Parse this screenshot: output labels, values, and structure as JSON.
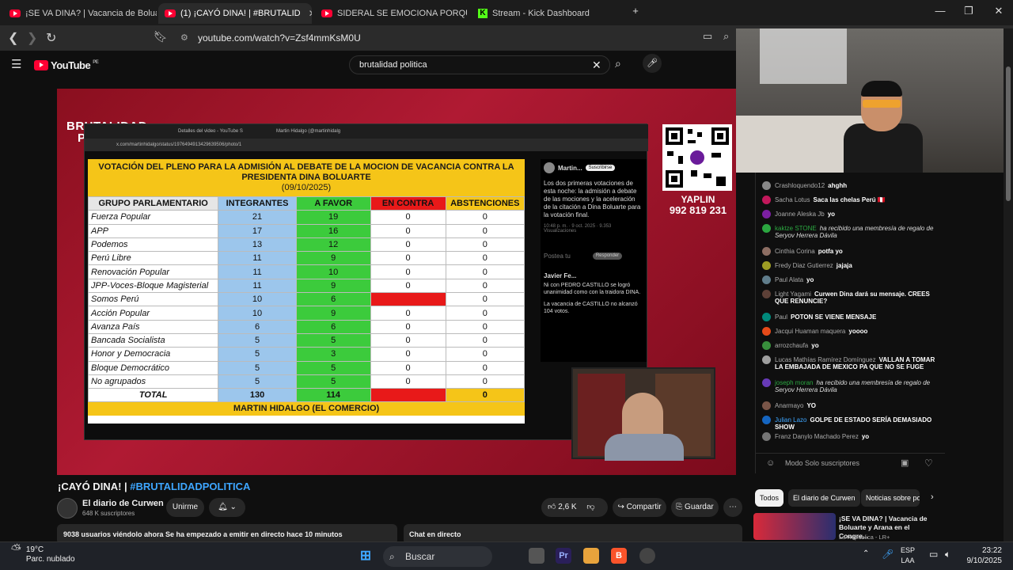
{
  "browser": {
    "tabs": [
      {
        "label": "¡SE VA DINA? | Vacancia de Bolua",
        "active": false
      },
      {
        "label": "(1) ¡CAYÓ DINA! | #BRUTALID",
        "active": true
      },
      {
        "label": "SIDERAL SE EMOCIONA PORQUE KIC",
        "active": false
      },
      {
        "label": "Stream - Kick Dashboard",
        "active": false
      }
    ],
    "url": "youtube.com/watch?v=Zsf4mmKsM0U"
  },
  "youtube": {
    "logo_text": "YouTube",
    "country": "PE",
    "search_value": "brutalidad politica"
  },
  "video": {
    "brand_line1": "BRUTALIDAD",
    "brand_line2": "POLÍTICA",
    "screen_tabs": [
      "Detalles del video - YouTube S",
      "Martin Hidalgo (@martinhidalg"
    ],
    "screen_url": "x.com/martinhidalgo/status/1976494913429639506/photo/1",
    "table_title": "VOTACIÓN DEL PLENO PARA LA ADMISIÓN AL DEBATE DE LA MOCION DE VACANCIA CONTRA LA PRESIDENTA DINA BOLUARTE",
    "table_date": "(09/10/2025)",
    "headers": [
      "GRUPO PARLAMENTARIO",
      "INTEGRANTES",
      "A FAVOR",
      "EN CONTRA",
      "ABSTENCIONES"
    ],
    "rows": [
      {
        "g": "Fuerza Popular",
        "i": "21",
        "f": "19",
        "c": "0",
        "a": "0"
      },
      {
        "g": "APP",
        "i": "17",
        "f": "16",
        "c": "0",
        "a": "0"
      },
      {
        "g": "Podemos",
        "i": "13",
        "f": "12",
        "c": "0",
        "a": "0"
      },
      {
        "g": "Perú Libre",
        "i": "11",
        "f": "9",
        "c": "0",
        "a": "0"
      },
      {
        "g": "Renovación Popular",
        "i": "11",
        "f": "10",
        "c": "0",
        "a": "0"
      },
      {
        "g": "JPP-Voces-Bloque Magisterial",
        "i": "11",
        "f": "9",
        "c": "0",
        "a": "0"
      },
      {
        "g": "Somos Perú",
        "i": "10",
        "f": "6",
        "c": "",
        "a": "0"
      },
      {
        "g": "Acción Popular",
        "i": "10",
        "f": "9",
        "c": "0",
        "a": "0"
      },
      {
        "g": "Avanza País",
        "i": "6",
        "f": "6",
        "c": "0",
        "a": "0"
      },
      {
        "g": "Bancada Socialista",
        "i": "5",
        "f": "5",
        "c": "0",
        "a": "0"
      },
      {
        "g": "Honor y Democracia",
        "i": "5",
        "f": "3",
        "c": "0",
        "a": "0"
      },
      {
        "g": "Bloque Democrático",
        "i": "5",
        "f": "5",
        "c": "0",
        "a": "0"
      },
      {
        "g": "No agrupados",
        "i": "5",
        "f": "5",
        "c": "0",
        "a": "0"
      }
    ],
    "total": {
      "label": "TOTAL",
      "i": "130",
      "f": "114",
      "c": "",
      "a": "0"
    },
    "footer": "MARTIN HIDALGO (EL COMERCIO)",
    "tweet_side": {
      "author": "Martin...",
      "follow": "Suscribirse",
      "text": "Los dos primeras votaciones de esta noche: la admisión a debate de las mociones y la aceleración de la citación a Dina Boluarte para la votación final.",
      "meta": "10:48 p. m. · 9 oct. 2025 · 9.353 Visualizaciones",
      "reply_placeholder": "Postea tu",
      "reply_btn": "Responder",
      "reply_author": "Javier Fe...",
      "reply_text": "Ni con PEDRO CASTILLO se logró unanimidad como con la traidora DINA.",
      "reply_text2": "La vacancia de CASTILLO no alcanzó 104 votos."
    },
    "qr_label1": "YAPLIN",
    "qr_label2": "992 819 231"
  },
  "below": {
    "title_plain": "¡CAYÓ DINA! | ",
    "title_tag": "#BRUTALIDADPOLITICA",
    "channel": "El diario de Curwen",
    "subs": "648 K suscriptores",
    "join": "Unirme",
    "likes": "2,6 K",
    "share": "Compartir",
    "save": "Guardar",
    "desc": "9038 usuarios viéndolo ahora  Se ha empezado a emitir en directo hace 10 minutos",
    "chat_live": "Chat en directo"
  },
  "chat": {
    "messages": [
      {
        "author": "Crashloquendo12",
        "text": "ahghh",
        "color": "#888",
        "type": "normal"
      },
      {
        "author": "Sacha Lotus",
        "text": "Saca las chelas Perú 🇵🇪",
        "color": "#c2185b",
        "type": "normal"
      },
      {
        "author": "Joanne Aleska Jb",
        "text": "yo",
        "color": "#7b1fa2",
        "type": "normal"
      },
      {
        "author": "kaktze STONE",
        "text": "ha recibido una membresía de regalo de Seryov Herrera Dávila",
        "color": "#2ba640",
        "type": "member"
      },
      {
        "author": "Cinthia Corina",
        "text": "potfa yo",
        "color": "#8d6e63",
        "type": "normal"
      },
      {
        "author": "Fredy Diaz Gutierrez",
        "text": "jajaja",
        "color": "#9e9d24",
        "type": "normal"
      },
      {
        "author": "Paul Alata",
        "text": "yo",
        "color": "#607d8b",
        "type": "normal"
      },
      {
        "author": "Light Yagami",
        "text": "Curwen Dina dará su mensaje. CREES QUE RENUNCIE?",
        "color": "#5d4037",
        "type": "normal"
      },
      {
        "author": "Paul",
        "text": "POTON SE VIENE MENSAJE",
        "color": "#00897b",
        "type": "normal"
      },
      {
        "author": "Jacqui Huaman maquera",
        "text": "yoooo",
        "color": "#e64a19",
        "type": "normal"
      },
      {
        "author": "arrozchaufa",
        "text": "yo",
        "color": "#388e3c",
        "type": "normal"
      },
      {
        "author": "Lucas Mathías Ramírez Domínguez",
        "text": "VALLAN A TOMAR LA EMBAJADA DE MEXICO PA QUE NO SE FUGE",
        "color": "#9e9e9e",
        "type": "normal"
      },
      {
        "author": "joseph moran",
        "text": "ha recibido una membresía de regalo de Seryov Herrera Dávila",
        "color": "#673ab7",
        "type": "member"
      },
      {
        "author": "Anarmayo",
        "text": "YO",
        "color": "#795548",
        "type": "normal"
      },
      {
        "author": "Julian Lazo",
        "text": "GOLPE DE ESTADO SERÍA DEMASIADO SHOW",
        "color": "#1565c0",
        "type": "blue"
      },
      {
        "author": "Franz Danylo Machado Perez",
        "text": "yo",
        "color": "#757575",
        "type": "normal"
      }
    ],
    "footer": "Modo Solo suscriptores"
  },
  "recs": {
    "chips": [
      "Todos",
      "El diario de Curwen",
      "Noticias sobre po"
    ],
    "title": "¡SE VA DINA? | Vacancia de Boluarte y Arana en el Congre...",
    "sub": "La República - LR+"
  },
  "taskbar": {
    "temp": "19°C",
    "weather": "Parc. nublado",
    "search": "Buscar",
    "lang1": "ESP",
    "lang2": "LAA",
    "time": "23:22",
    "date": "9/10/2025"
  },
  "colors": {
    "yt_red": "#ff0033",
    "favor": "#3ccb3c",
    "contra": "#e81919",
    "integrantes": "#9cc6ec",
    "header_yellow": "#f5c518"
  }
}
